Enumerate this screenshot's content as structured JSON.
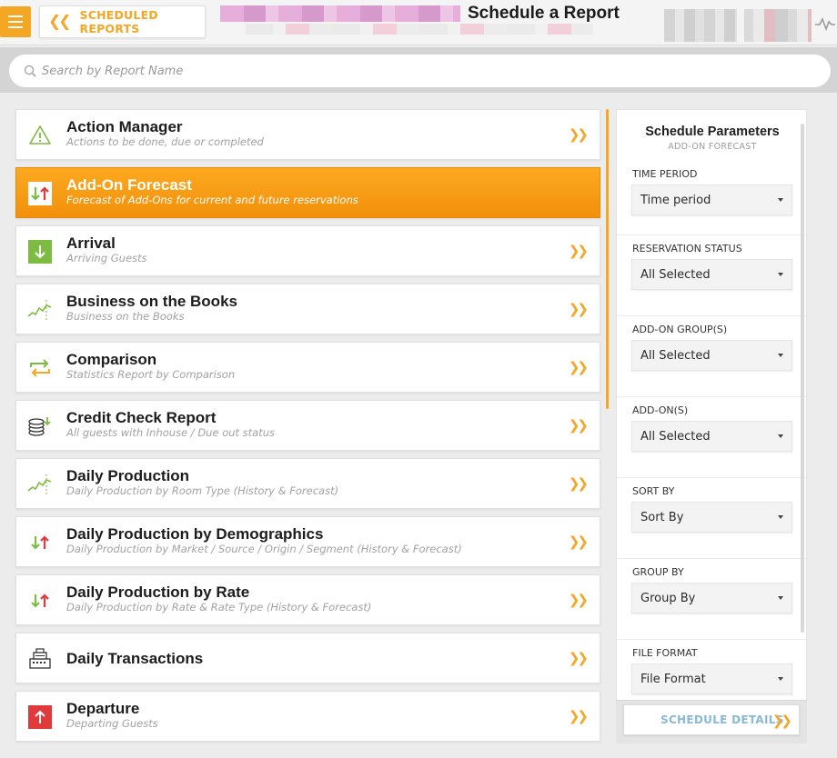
{
  "header": {
    "back_label": "SCHEDULED REPORTS",
    "page_title": "Schedule a Report"
  },
  "search": {
    "placeholder": "Search by Report Name"
  },
  "reports": [
    {
      "title": "Action Manager",
      "subtitle": "Actions to be done, due or completed",
      "icon": "warning-triangle-icon"
    },
    {
      "title": "Add-On Forecast",
      "subtitle": "Forecast of Add-Ons for current and future reservations",
      "icon": "down-up-arrows-icon",
      "active": true
    },
    {
      "title": "Arrival",
      "subtitle": "Arriving Guests",
      "icon": "arrival-down-arrow-icon"
    },
    {
      "title": "Business on the Books",
      "subtitle": "Business on the Books",
      "icon": "trend-line-icon"
    },
    {
      "title": "Comparison",
      "subtitle": "Statistics Report by Comparison",
      "icon": "compare-arrows-icon"
    },
    {
      "title": "Credit Check Report",
      "subtitle": "All guests with Inhouse / Due out status",
      "icon": "coins-stack-icon"
    },
    {
      "title": "Daily Production",
      "subtitle": "Daily Production by Room Type (History & Forecast)",
      "icon": "trend-line-icon"
    },
    {
      "title": "Daily Production by Demographics",
      "subtitle": "Daily Production by Market / Source / Origin / Segment (History & Forecast)",
      "icon": "down-up-arrows-icon"
    },
    {
      "title": "Daily Production by Rate",
      "subtitle": "Daily Production by Rate & Rate Type (History & Forecast)",
      "icon": "down-up-arrows-icon"
    },
    {
      "title": "Daily Transactions",
      "subtitle": "",
      "icon": "cash-register-icon"
    },
    {
      "title": "Departure",
      "subtitle": "Departing Guests",
      "icon": "departure-up-arrow-icon"
    }
  ],
  "panel": {
    "title": "Schedule Parameters",
    "subtitle": "ADD-ON FORECAST",
    "fields": [
      {
        "label": "TIME PERIOD",
        "value": "Time period"
      },
      {
        "label": "RESERVATION STATUS",
        "value": "All Selected"
      },
      {
        "label": "ADD-ON GROUP(S)",
        "value": "All Selected"
      },
      {
        "label": "ADD-ON(S)",
        "value": "All Selected"
      },
      {
        "label": "SORT BY",
        "value": "Sort By"
      },
      {
        "label": "GROUP BY",
        "value": "Group By"
      },
      {
        "label": "FILE FORMAT",
        "value": "File Format"
      }
    ],
    "schedule_button": "SCHEDULE DETAILS"
  },
  "colors": {
    "accent": "#f5a623",
    "active_row": "#f7991a",
    "green": "#7dbb42",
    "red": "#e03a3a",
    "button_text": "#8ab9d6"
  }
}
